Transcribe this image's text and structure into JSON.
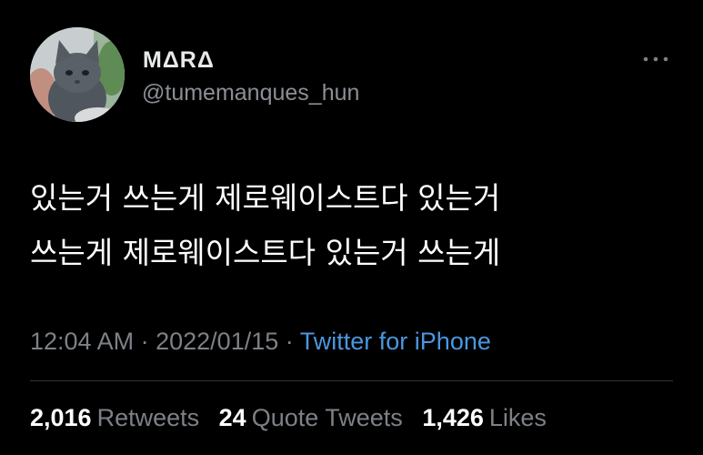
{
  "tweet": {
    "author": {
      "display_name": "MΔRΔ",
      "handle": "@tumemanques_hun",
      "avatar": "kitten-photo"
    },
    "text_lines": [
      "있는거 쓰는게 제로웨이스트다 있는거",
      "쓰는게 제로웨이스트다 있는거 쓰는게"
    ],
    "time": "12:04 AM",
    "separator": "·",
    "date": "2022/01/15",
    "source": "Twitter for iPhone",
    "stats": {
      "retweets_count": "2,016",
      "retweets_label": "Retweets",
      "quotes_count": "24",
      "quotes_label": "Quote Tweets",
      "likes_count": "1,426",
      "likes_label": "Likes"
    },
    "icons": {
      "more": "more-options-icon"
    }
  },
  "colors": {
    "background": "#000000",
    "primary_text": "#ffffff",
    "secondary_text": "#7d8187",
    "link": "#4a97e0",
    "divider": "#2f3336"
  }
}
